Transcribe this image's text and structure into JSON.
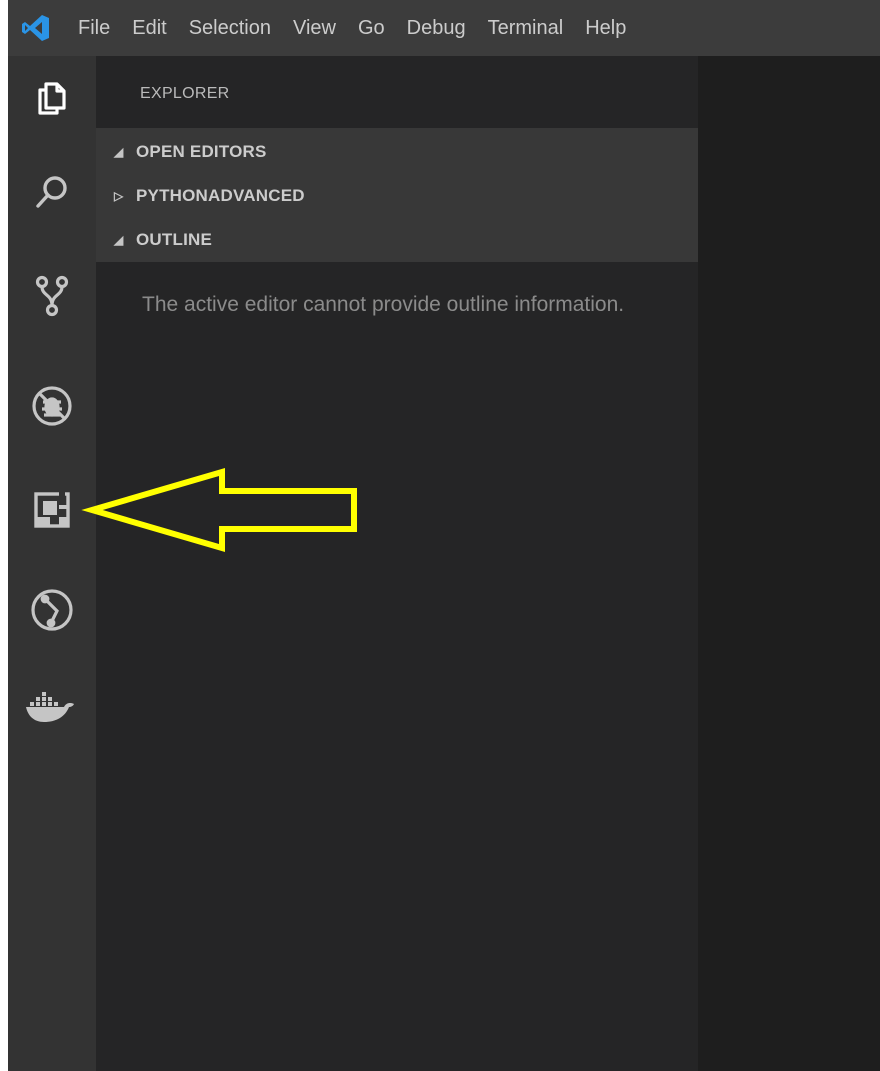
{
  "menubar": {
    "logo_icon": "vscode-logo-icon",
    "items": [
      "File",
      "Edit",
      "Selection",
      "View",
      "Go",
      "Debug",
      "Terminal",
      "Help"
    ]
  },
  "activitybar": {
    "icons": [
      "files-icon",
      "search-icon",
      "source-control-icon",
      "debug-icon",
      "extensions-icon",
      "gitlens-icon",
      "docker-icon"
    ]
  },
  "sidebar": {
    "title": "EXPLORER",
    "sections": [
      {
        "label": "OPEN EDITORS",
        "expanded": true,
        "twisty": "◢"
      },
      {
        "label": "PYTHONADVANCED",
        "expanded": false,
        "twisty": "▷"
      },
      {
        "label": "OUTLINE",
        "expanded": true,
        "twisty": "◢"
      }
    ],
    "outline_message": "The active editor cannot provide outline information."
  },
  "colors": {
    "menubar_bg": "#3c3c3c",
    "activitybar_bg": "#333333",
    "sidebar_bg": "#252526",
    "section_bg": "#383838",
    "editor_bg": "#1e1e1e",
    "logo_blue": "#2a94e6",
    "callout_yellow": "#ffff00"
  },
  "annotation": {
    "shape": "arrow-left",
    "points_to": "extensions-icon"
  }
}
